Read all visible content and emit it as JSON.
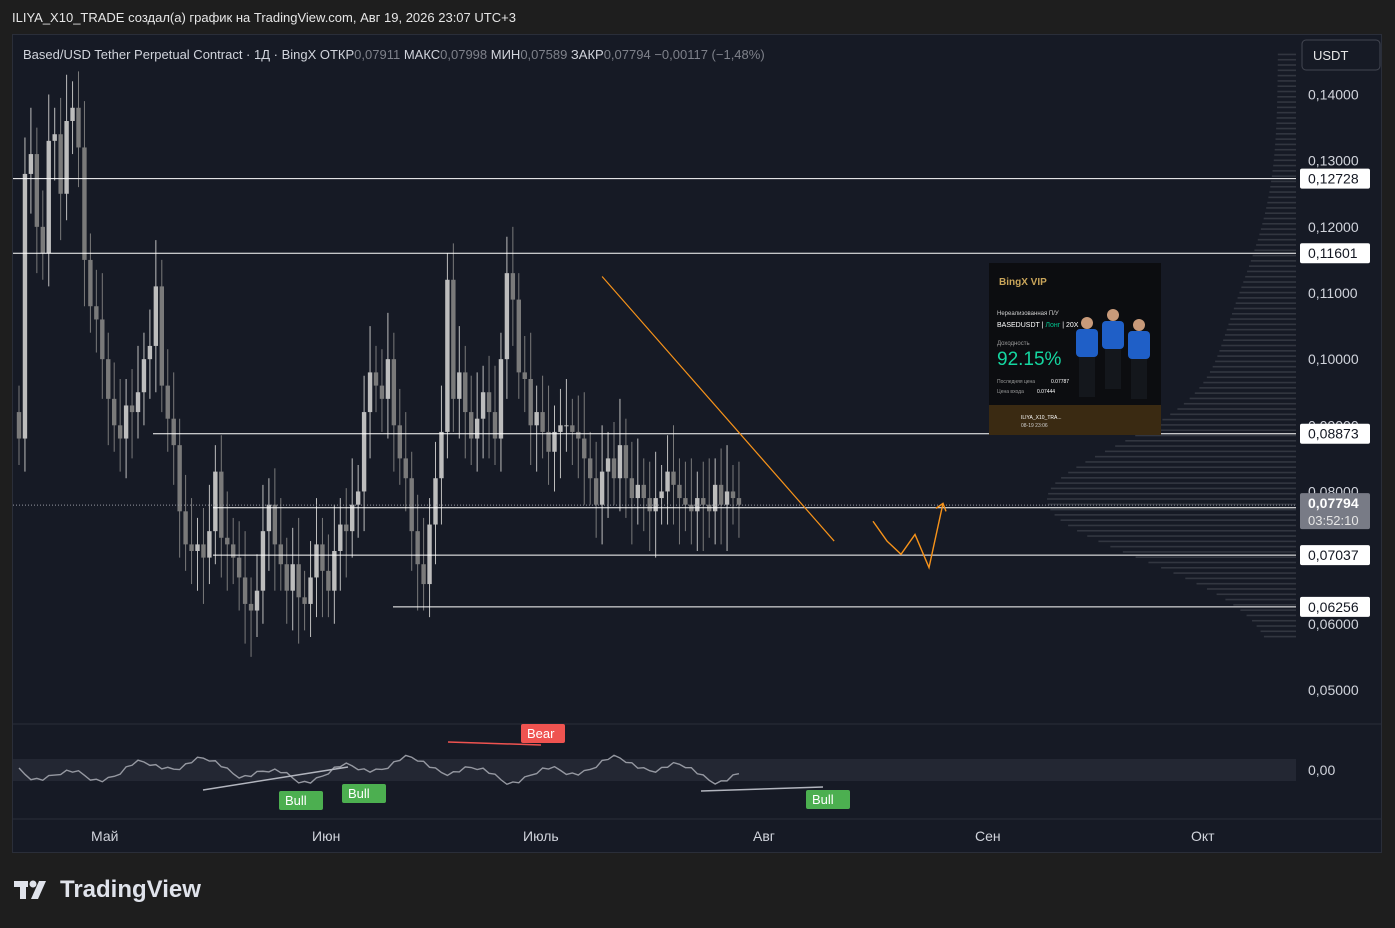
{
  "header": {
    "byline": "ILIYA_X10_TRADE создал(а) график на TradingView.com, Авг 19, 2026 23:07 UTC+3",
    "symbol": "Based/USD Tether Perpetual Contract · 1Д · BingX",
    "open_label": "ОТКР",
    "open": "0,07911",
    "high_label": "МАКС",
    "high": "0,07998",
    "low_label": "МИН",
    "low": "0,07589",
    "close_label": "ЗАКР",
    "close": "0,07794",
    "change": "−0,00117 (−1,48%)",
    "currency": "USDT"
  },
  "chart_data": {
    "type": "candlestick",
    "symbol": "BASEDUSDT",
    "timeframe": "1D",
    "x_months": [
      "Май",
      "Июн",
      "Июль",
      "Авг",
      "Сен",
      "Окт"
    ],
    "ylim": [
      0.045,
      0.149
    ],
    "y_ticks": [
      "0,14000",
      "0,13000",
      "0,12000",
      "0,11000",
      "0,10000",
      "0,09000",
      "0,08000",
      "0,06000",
      "0,05000"
    ],
    "closes": [
      0.088,
      0.128,
      0.131,
      0.12,
      0.116,
      0.133,
      0.134,
      0.125,
      0.136,
      0.138,
      0.132,
      0.115,
      0.108,
      0.106,
      0.1,
      0.094,
      0.09,
      0.088,
      0.093,
      0.092,
      0.095,
      0.1,
      0.102,
      0.111,
      0.096,
      0.091,
      0.087,
      0.077,
      0.072,
      0.071,
      0.072,
      0.07,
      0.074,
      0.083,
      0.073,
      0.072,
      0.07,
      0.067,
      0.063,
      0.062,
      0.065,
      0.074,
      0.078,
      0.072,
      0.069,
      0.065,
      0.069,
      0.064,
      0.063,
      0.067,
      0.072,
      0.068,
      0.065,
      0.071,
      0.075,
      0.074,
      0.078,
      0.08,
      0.092,
      0.098,
      0.096,
      0.094,
      0.1,
      0.09,
      0.085,
      0.082,
      0.074,
      0.069,
      0.066,
      0.075,
      0.082,
      0.089,
      0.112,
      0.094,
      0.098,
      0.092,
      0.088,
      0.091,
      0.095,
      0.092,
      0.088,
      0.1,
      0.113,
      0.109,
      0.098,
      0.097,
      0.09,
      0.092,
      0.089,
      0.086,
      0.089,
      0.09,
      0.09,
      0.089,
      0.088,
      0.085,
      0.082,
      0.078,
      0.083,
      0.085,
      0.082,
      0.087,
      0.082,
      0.079,
      0.081,
      0.079,
      0.077,
      0.079,
      0.08,
      0.083,
      0.081,
      0.079,
      0.078,
      0.077,
      0.079,
      0.078,
      0.077,
      0.081,
      0.078,
      0.08,
      0.079,
      0.078
    ],
    "horizontal_levels": [
      "0,12728",
      "0,11601",
      "0,08873",
      "0,07754",
      "0,07037",
      "0,06256"
    ],
    "last_price": "0,07794",
    "countdown": "03:52:10",
    "projection_path": [
      [
        0.0755,
        0.0725
      ],
      [
        0.0705,
        0.0735
      ],
      [
        0.0685,
        0.0782
      ]
    ],
    "trendline": [
      [
        0.1125,
        0.0725
      ]
    ],
    "oscillator": {
      "zero_label": "0,00",
      "signals": [
        {
          "label": "Bull",
          "color": "#4caf50"
        },
        {
          "label": "Bull",
          "color": "#4caf50"
        },
        {
          "label": "Bear",
          "color": "#ef5350"
        },
        {
          "label": "Bull",
          "color": "#4caf50"
        }
      ]
    }
  },
  "overlay_card": {
    "brand": "BingX VIP",
    "subtitle": "Нереализованная П/У",
    "pair": "BASEDUSDT",
    "side": "Лонг",
    "leverage": "20X",
    "pnl_label": "Доходность",
    "pnl": "92.15%",
    "last_price_label": "Последняя цена",
    "last_price": "0.07787",
    "entry_label": "Цена входа",
    "entry": "0.07444",
    "user": "ILIYA_X10_TRA...",
    "time": "08-19 23:06"
  },
  "footer": {
    "brand": "TradingView"
  },
  "colors": {
    "bg": "#161a25",
    "up": "#bdbdbd",
    "down": "#7a7a7a",
    "level": "#ffffff",
    "annot": "#f7931a",
    "bull": "#4caf50",
    "bear": "#ef5350"
  }
}
